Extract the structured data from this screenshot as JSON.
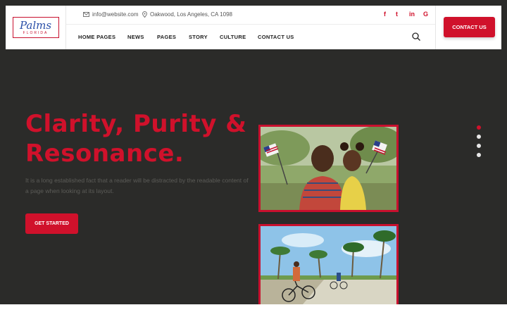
{
  "brand": {
    "logo_main": "Palms",
    "logo_sub": "FLORIDA"
  },
  "topbar": {
    "email": "info@website.com",
    "address": "Oakwood, Los Angeles, CA 1098",
    "social": [
      "f",
      "t",
      "in",
      "G"
    ]
  },
  "nav": {
    "items": [
      "HOME PAGES",
      "NEWS",
      "PAGES",
      "STORY",
      "CULTURE",
      "CONTACT US"
    ]
  },
  "header_cta": "CONTACT US",
  "hero": {
    "title_line1": "Clarity, Purity &",
    "title_line2": "Resonance.",
    "text": "It is a long established fact that a reader will be distracted by the readable content of a page when looking at its layout.",
    "button": "GET STARTED"
  },
  "slider": {
    "slides": 4,
    "active_index": 0
  },
  "colors": {
    "accent": "#d0112b",
    "background": "#2b2b29",
    "header": "#ffffff"
  },
  "icons": [
    "email-icon",
    "location-icon",
    "facebook-icon",
    "twitter-icon",
    "linkedin-icon",
    "google-icon",
    "search-icon"
  ]
}
